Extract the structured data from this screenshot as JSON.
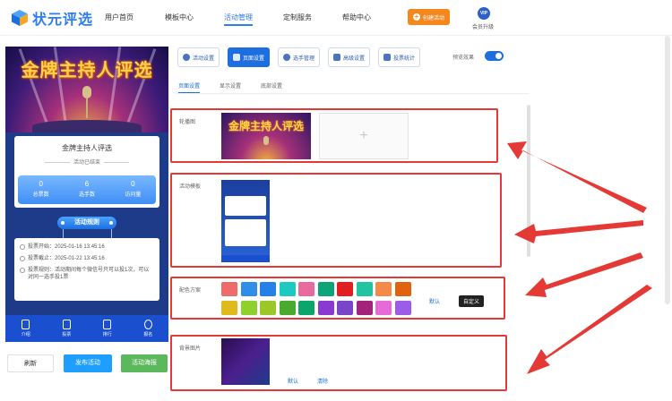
{
  "header": {
    "logo_text": "状元评选",
    "nav": [
      "用户首页",
      "模板中心",
      "活动管理",
      "定制服务",
      "帮助中心"
    ],
    "active_nav": "活动管理",
    "create_label": "创建活动",
    "vip_badge": "VIP",
    "vip_label": "会员升级"
  },
  "preview": {
    "banner_title": "金牌主持人评选",
    "card_title": "金牌主持人评选",
    "card_status": "活动已结束",
    "stats": [
      {
        "value": "0",
        "label": "总票数"
      },
      {
        "value": "6",
        "label": "选手数"
      },
      {
        "value": "0",
        "label": "访问量"
      }
    ],
    "rule_button": "活动规则",
    "info_rows": [
      "投票开始：2025-01-16 13:45:16",
      "投票截止：2025-01-22 13:45:16",
      "投票规则：活动期间每个微信号只可以投1次，可以对同一选手投1票"
    ],
    "bottom_nav": [
      "介绍",
      "投票",
      "排行",
      "报名"
    ]
  },
  "actions": {
    "refresh": "刷新",
    "publish": "发布活动",
    "qr": "活动海报"
  },
  "toolbar": {
    "tabs": [
      "活动设置",
      "页面设置",
      "选手管理",
      "高级设置",
      "投票统计"
    ],
    "active_tab": "页面设置",
    "preview_label": "预览效果",
    "preview_enabled": true
  },
  "subtabs": {
    "items": [
      "页面设置",
      "显示设置",
      "底部设置"
    ],
    "active": "页面设置"
  },
  "sections": {
    "carousel_label": "轮播图",
    "carousel_add": "+",
    "template_label": "活动模板",
    "color_label": "配色方案",
    "color_default": "默认",
    "color_custom": "自定义",
    "swatches_row1": [
      "#f06a6a",
      "#2e8ee8",
      "#2680eb",
      "#1ec9c1",
      "#e86aa0",
      "#0da47a",
      "#e02020",
      "#21c4a0",
      "#f5894a",
      "#e06410"
    ],
    "swatches_row2": [
      "#e0ba1a",
      "#8fd12c",
      "#9bc828",
      "#4aaa30",
      "#0ca56a",
      "#8a3ad0",
      "#7b45c8",
      "#a3227a",
      "#e86ad8",
      "#9b5ce8"
    ],
    "bg_label": "背景图片",
    "bg_default": "默认",
    "bg_clear": "清除"
  }
}
